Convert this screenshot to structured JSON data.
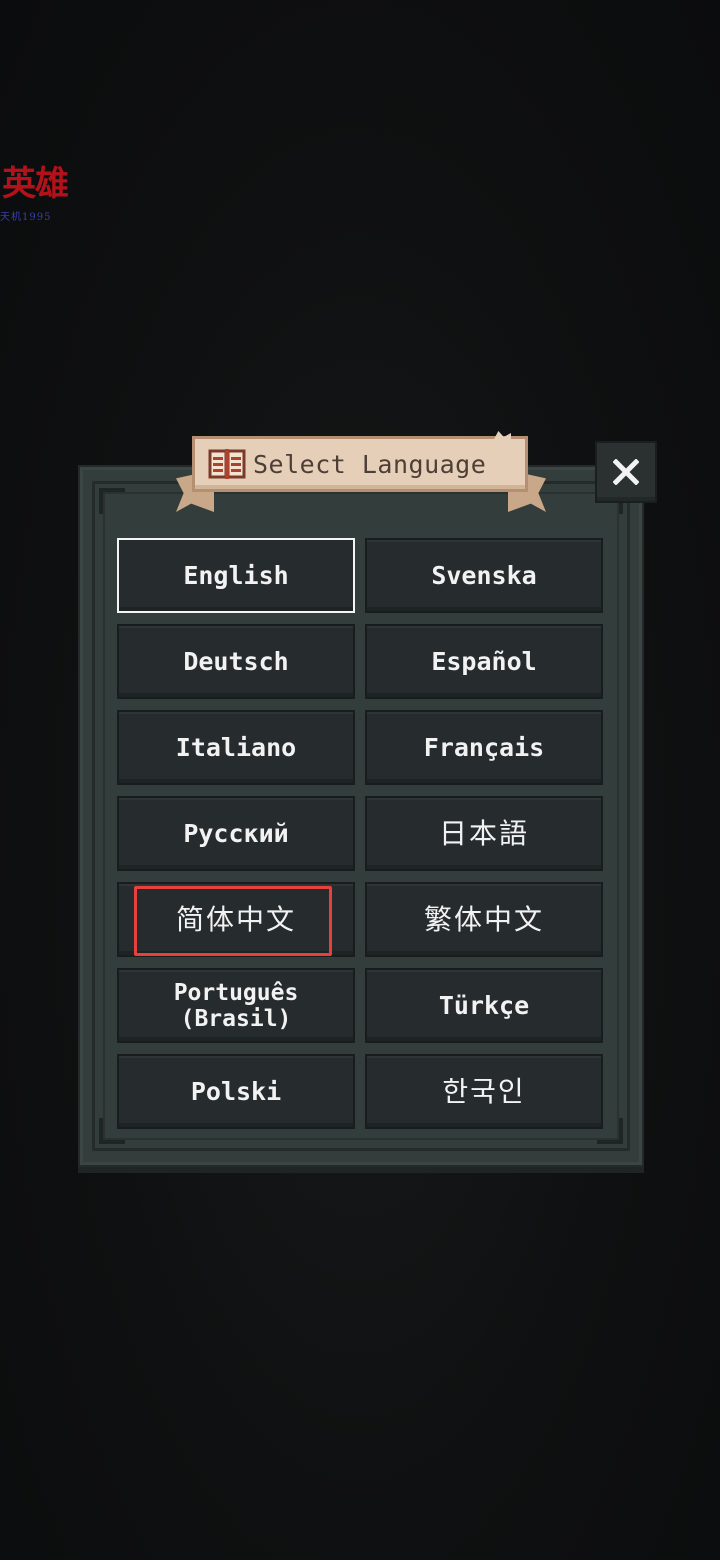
{
  "watermark": {
    "main_text": "英雄",
    "sub_text": "天机1995"
  },
  "dialog": {
    "title": "Select Language",
    "title_icon": "book-icon",
    "close_icon": "close-icon"
  },
  "languages": [
    {
      "label": "English",
      "selected": true
    },
    {
      "label": "Svenska"
    },
    {
      "label": "Deutsch"
    },
    {
      "label": "Español"
    },
    {
      "label": "Italiano"
    },
    {
      "label": "Français"
    },
    {
      "label": "Русский"
    },
    {
      "label": "日本語"
    },
    {
      "label": "简体中文",
      "highlighted": true
    },
    {
      "label": "繁体中文"
    },
    {
      "label": "Português (Brasil)"
    },
    {
      "label": "Türkçe"
    },
    {
      "label": "Polski"
    },
    {
      "label": "한국인"
    }
  ],
  "colors": {
    "highlight_box": "#e8413d",
    "banner": "#e6cfb8",
    "panel": "#333d3b"
  }
}
